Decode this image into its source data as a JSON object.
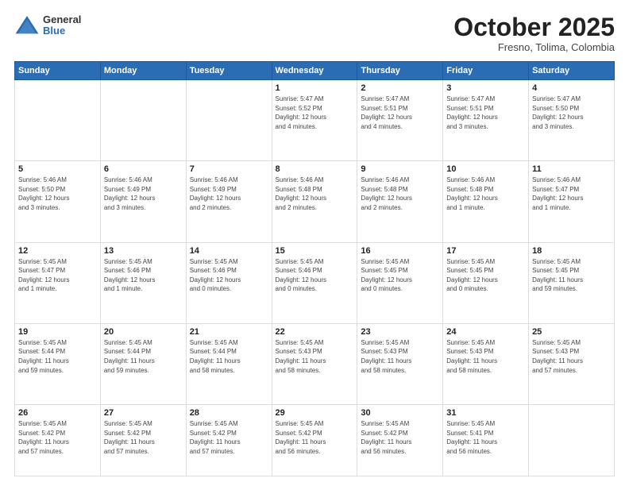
{
  "logo": {
    "general": "General",
    "blue": "Blue"
  },
  "title": {
    "month": "October 2025",
    "location": "Fresno, Tolima, Colombia"
  },
  "weekdays": [
    "Sunday",
    "Monday",
    "Tuesday",
    "Wednesday",
    "Thursday",
    "Friday",
    "Saturday"
  ],
  "weeks": [
    [
      {
        "day": "",
        "info": ""
      },
      {
        "day": "",
        "info": ""
      },
      {
        "day": "",
        "info": ""
      },
      {
        "day": "1",
        "info": "Sunrise: 5:47 AM\nSunset: 5:52 PM\nDaylight: 12 hours\nand 4 minutes."
      },
      {
        "day": "2",
        "info": "Sunrise: 5:47 AM\nSunset: 5:51 PM\nDaylight: 12 hours\nand 4 minutes."
      },
      {
        "day": "3",
        "info": "Sunrise: 5:47 AM\nSunset: 5:51 PM\nDaylight: 12 hours\nand 3 minutes."
      },
      {
        "day": "4",
        "info": "Sunrise: 5:47 AM\nSunset: 5:50 PM\nDaylight: 12 hours\nand 3 minutes."
      }
    ],
    [
      {
        "day": "5",
        "info": "Sunrise: 5:46 AM\nSunset: 5:50 PM\nDaylight: 12 hours\nand 3 minutes."
      },
      {
        "day": "6",
        "info": "Sunrise: 5:46 AM\nSunset: 5:49 PM\nDaylight: 12 hours\nand 3 minutes."
      },
      {
        "day": "7",
        "info": "Sunrise: 5:46 AM\nSunset: 5:49 PM\nDaylight: 12 hours\nand 2 minutes."
      },
      {
        "day": "8",
        "info": "Sunrise: 5:46 AM\nSunset: 5:48 PM\nDaylight: 12 hours\nand 2 minutes."
      },
      {
        "day": "9",
        "info": "Sunrise: 5:46 AM\nSunset: 5:48 PM\nDaylight: 12 hours\nand 2 minutes."
      },
      {
        "day": "10",
        "info": "Sunrise: 5:46 AM\nSunset: 5:48 PM\nDaylight: 12 hours\nand 1 minute."
      },
      {
        "day": "11",
        "info": "Sunrise: 5:46 AM\nSunset: 5:47 PM\nDaylight: 12 hours\nand 1 minute."
      }
    ],
    [
      {
        "day": "12",
        "info": "Sunrise: 5:45 AM\nSunset: 5:47 PM\nDaylight: 12 hours\nand 1 minute."
      },
      {
        "day": "13",
        "info": "Sunrise: 5:45 AM\nSunset: 5:46 PM\nDaylight: 12 hours\nand 1 minute."
      },
      {
        "day": "14",
        "info": "Sunrise: 5:45 AM\nSunset: 5:46 PM\nDaylight: 12 hours\nand 0 minutes."
      },
      {
        "day": "15",
        "info": "Sunrise: 5:45 AM\nSunset: 5:46 PM\nDaylight: 12 hours\nand 0 minutes."
      },
      {
        "day": "16",
        "info": "Sunrise: 5:45 AM\nSunset: 5:45 PM\nDaylight: 12 hours\nand 0 minutes."
      },
      {
        "day": "17",
        "info": "Sunrise: 5:45 AM\nSunset: 5:45 PM\nDaylight: 12 hours\nand 0 minutes."
      },
      {
        "day": "18",
        "info": "Sunrise: 5:45 AM\nSunset: 5:45 PM\nDaylight: 11 hours\nand 59 minutes."
      }
    ],
    [
      {
        "day": "19",
        "info": "Sunrise: 5:45 AM\nSunset: 5:44 PM\nDaylight: 11 hours\nand 59 minutes."
      },
      {
        "day": "20",
        "info": "Sunrise: 5:45 AM\nSunset: 5:44 PM\nDaylight: 11 hours\nand 59 minutes."
      },
      {
        "day": "21",
        "info": "Sunrise: 5:45 AM\nSunset: 5:44 PM\nDaylight: 11 hours\nand 58 minutes."
      },
      {
        "day": "22",
        "info": "Sunrise: 5:45 AM\nSunset: 5:43 PM\nDaylight: 11 hours\nand 58 minutes."
      },
      {
        "day": "23",
        "info": "Sunrise: 5:45 AM\nSunset: 5:43 PM\nDaylight: 11 hours\nand 58 minutes."
      },
      {
        "day": "24",
        "info": "Sunrise: 5:45 AM\nSunset: 5:43 PM\nDaylight: 11 hours\nand 58 minutes."
      },
      {
        "day": "25",
        "info": "Sunrise: 5:45 AM\nSunset: 5:43 PM\nDaylight: 11 hours\nand 57 minutes."
      }
    ],
    [
      {
        "day": "26",
        "info": "Sunrise: 5:45 AM\nSunset: 5:42 PM\nDaylight: 11 hours\nand 57 minutes."
      },
      {
        "day": "27",
        "info": "Sunrise: 5:45 AM\nSunset: 5:42 PM\nDaylight: 11 hours\nand 57 minutes."
      },
      {
        "day": "28",
        "info": "Sunrise: 5:45 AM\nSunset: 5:42 PM\nDaylight: 11 hours\nand 57 minutes."
      },
      {
        "day": "29",
        "info": "Sunrise: 5:45 AM\nSunset: 5:42 PM\nDaylight: 11 hours\nand 56 minutes."
      },
      {
        "day": "30",
        "info": "Sunrise: 5:45 AM\nSunset: 5:42 PM\nDaylight: 11 hours\nand 56 minutes."
      },
      {
        "day": "31",
        "info": "Sunrise: 5:45 AM\nSunset: 5:41 PM\nDaylight: 11 hours\nand 56 minutes."
      },
      {
        "day": "",
        "info": ""
      }
    ]
  ]
}
